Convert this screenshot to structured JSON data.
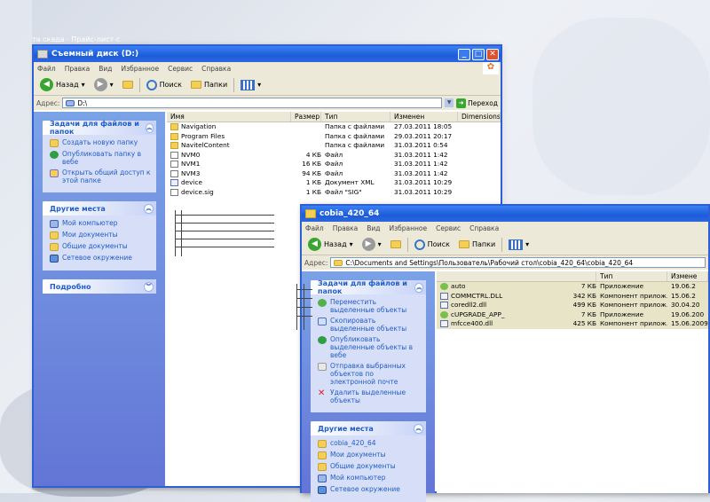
{
  "background": {
    "text": "та скада · Прайс-лист с"
  },
  "win1": {
    "title": "Съемный диск (D:)",
    "menu": [
      "Файл",
      "Правка",
      "Вид",
      "Избранное",
      "Сервис",
      "Справка"
    ],
    "toolbar": {
      "back": "Назад",
      "search": "Поиск",
      "folders": "Папки"
    },
    "address": {
      "label": "Адрес:",
      "value": "D:\\",
      "go": "Переход"
    },
    "tasks_panel": {
      "title": "Задачи для файлов и папок",
      "items": [
        "Создать новую папку",
        "Опубликовать папку в вебе",
        "Открыть общий доступ к этой папке"
      ]
    },
    "places_panel": {
      "title": "Другие места",
      "items": [
        "Мой компьютер",
        "Мои документы",
        "Общие документы",
        "Сетевое окружение"
      ]
    },
    "details_panel": {
      "title": "Подробно"
    },
    "columns": [
      "Имя",
      "Размер",
      "Тип",
      "Изменен",
      "Dimensions"
    ],
    "files": [
      {
        "name": "Navigation",
        "size": "",
        "type": "Папка с файлами",
        "date": "27.03.2011 18:05",
        "icon": "folder"
      },
      {
        "name": "Program Files",
        "size": "",
        "type": "Папка с файлами",
        "date": "29.03.2011 20:17",
        "icon": "folder"
      },
      {
        "name": "NavitelContent",
        "size": "",
        "type": "Папка с файлами",
        "date": "31.03.2011 0:54",
        "icon": "folder"
      },
      {
        "name": "NVM0",
        "size": "4 КБ",
        "type": "Файл",
        "date": "31.03.2011 1:42",
        "icon": "file"
      },
      {
        "name": "NVM1",
        "size": "16 КБ",
        "type": "Файл",
        "date": "31.03.2011 1:42",
        "icon": "file"
      },
      {
        "name": "NVM3",
        "size": "94 КБ",
        "type": "Файл",
        "date": "31.03.2011 1:42",
        "icon": "file"
      },
      {
        "name": "device",
        "size": "1 КБ",
        "type": "Документ XML",
        "date": "31.03.2011 10:29",
        "icon": "xml"
      },
      {
        "name": "device.sig",
        "size": "1 КБ",
        "type": "Файл \"SIG\"",
        "date": "31.03.2011 10:29",
        "icon": "file"
      }
    ]
  },
  "win2": {
    "title": "cobia_420_64",
    "menu": [
      "Файл",
      "Правка",
      "Вид",
      "Избранное",
      "Сервис",
      "Справка"
    ],
    "toolbar": {
      "back": "Назад",
      "search": "Поиск",
      "folders": "Папки"
    },
    "address": {
      "label": "Адрес:",
      "value": "C:\\Documents and Settings\\Пользователь\\Рабочий стол\\cobia_420_64\\cobia_420_64"
    },
    "tasks_panel": {
      "title": "Задачи для файлов и папок",
      "items": [
        "Переместить выделенные объекты",
        "Скопировать выделенные объекты",
        "Опубликовать выделенные объекты в вебе",
        "Отправка выбранных объектов по электронной почте",
        "Удалить выделенные объекты"
      ]
    },
    "places_panel": {
      "title": "Другие места",
      "items": [
        "cobia_420_64",
        "Мои документы",
        "Общие документы",
        "Мой компьютер",
        "Сетевое окружение"
      ]
    },
    "columns": [
      "",
      "Тип",
      "Измене"
    ],
    "files": [
      {
        "name": "auto",
        "size": "7 КБ",
        "type": "Приложение",
        "date": "19.06.2",
        "icon": "app"
      },
      {
        "name": "COMMCTRL.DLL",
        "size": "342 КБ",
        "type": "Компонент прилож...",
        "date": "15.06.2",
        "icon": "dll"
      },
      {
        "name": "coredll2.dll",
        "size": "499 КБ",
        "type": "Компонент прилож...",
        "date": "30.04.20",
        "icon": "dll"
      },
      {
        "name": "cUPGRADE_APP_",
        "size": "7 КБ",
        "type": "Приложение",
        "date": "19.06.200",
        "icon": "app"
      },
      {
        "name": "mfcce400.dll",
        "size": "425 КБ",
        "type": "Компонент прилож...",
        "date": "15.06.2009",
        "icon": "dll"
      }
    ]
  }
}
